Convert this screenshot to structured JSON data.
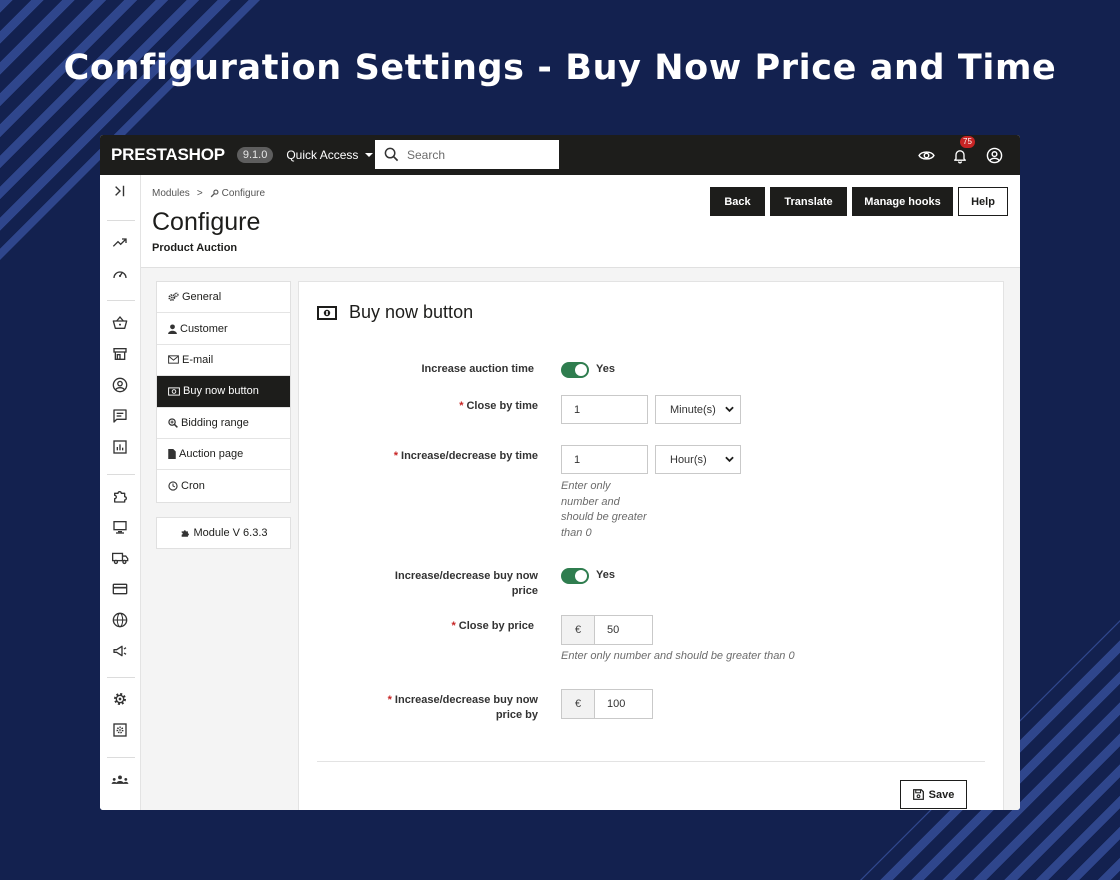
{
  "headline": "Configuration Settings - Buy Now Price and Time",
  "topbar": {
    "logo": "PRESTASHOP",
    "version": "9.1.0",
    "quick_access": "Quick Access",
    "search_placeholder": "Search",
    "notification_count": "75",
    "icons": [
      "eye-icon",
      "bell-icon",
      "user-circle-icon"
    ]
  },
  "sidenav": {
    "icons": [
      "collapse-icon",
      "trending-up-icon",
      "dashboard-gauge-icon",
      "basket-icon",
      "store-icon",
      "customer-icon",
      "messages-icon",
      "stats-icon",
      "modules-puzzle-icon",
      "monitor-icon",
      "truck-icon",
      "credit-card-icon",
      "globe-icon",
      "megaphone-icon",
      "settings-gear-icon",
      "advanced-settings-icon",
      "team-icon"
    ]
  },
  "header": {
    "breadcrumb": [
      "Modules",
      "Configure"
    ],
    "breadcrumb_sep": ">",
    "title": "Configure",
    "subtitle": "Product Auction",
    "buttons": {
      "back": "Back",
      "translate": "Translate",
      "manage_hooks": "Manage hooks",
      "help": "Help"
    }
  },
  "tabs": [
    {
      "label": "General",
      "icon": "cogs-icon",
      "active": false
    },
    {
      "label": "Customer",
      "icon": "user-icon",
      "active": false
    },
    {
      "label": "E-mail",
      "icon": "envelope-icon",
      "active": false
    },
    {
      "label": "Buy now button",
      "icon": "money-bill-icon",
      "active": true
    },
    {
      "label": "Bidding range",
      "icon": "search-plus-icon",
      "active": false
    },
    {
      "label": "Auction page",
      "icon": "file-icon",
      "active": false
    },
    {
      "label": "Cron",
      "icon": "clock-icon",
      "active": false
    }
  ],
  "module_version": "Module V 6.3.3",
  "panel": {
    "title": "Buy now button",
    "fields": {
      "increase_auction_time": {
        "label": "Increase auction time",
        "value": "Yes",
        "on": true
      },
      "close_by_time": {
        "label": "Close by time",
        "value": "1",
        "unit": "Minute(s)"
      },
      "increase_decrease_by_time": {
        "label": "Increase/decrease by time",
        "value": "1",
        "unit": "Hour(s)",
        "help": [
          "Enter only",
          "number and",
          "should be greater",
          "than 0"
        ]
      },
      "increase_decrease_buy_now_price": {
        "label_lines": [
          "Increase/decrease buy now",
          "price"
        ],
        "value": "Yes",
        "on": true
      },
      "close_by_price": {
        "label": "Close by price",
        "currency": "€",
        "value": "50",
        "help": "Enter only number and should be greater than 0"
      },
      "increase_decrease_buy_now_price_by": {
        "label_lines": [
          "Increase/decrease buy now",
          "price by"
        ],
        "currency": "€",
        "value": "100"
      }
    },
    "save": "Save"
  },
  "colors": {
    "background": "#13214f",
    "dark": "#1d1d1b",
    "toggle_on": "#2f7d4f",
    "required": "#c72424",
    "badge": "#c72424"
  }
}
